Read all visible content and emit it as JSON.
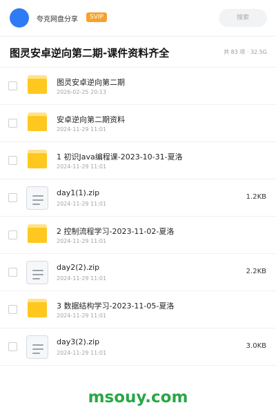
{
  "header": {
    "share_title": "夸克网盘分享",
    "badge": "SVIP",
    "search_placeholder": "搜索"
  },
  "folder": {
    "title": "图灵安卓逆向第二期-课件资料齐全",
    "summary": "共 83 项 · 32.5G"
  },
  "items": [
    {
      "type": "folder",
      "icon": "folder-icon",
      "name": "图灵安卓逆向第二期",
      "date": "2026-02-25 20:13",
      "size": ""
    },
    {
      "type": "folder",
      "icon": "folder-icon",
      "name": "安卓逆向第二期资料",
      "date": "2024-11-29 11:01",
      "size": ""
    },
    {
      "type": "folder",
      "icon": "folder-icon",
      "name": "1 初识Java编程课-2023-10-31-夏洛",
      "date": "2024-11-29 11:01",
      "size": ""
    },
    {
      "type": "file",
      "icon": "file-icon",
      "name": "day1(1).zip",
      "date": "2024-11-29 11:01",
      "size": "1.2KB"
    },
    {
      "type": "folder",
      "icon": "folder-icon",
      "name": "2 控制流程学习-2023-11-02-夏洛",
      "date": "2024-11-29 11:01",
      "size": ""
    },
    {
      "type": "file",
      "icon": "file-icon",
      "name": "day2(2).zip",
      "date": "2024-11-29 11:01",
      "size": "2.2KB"
    },
    {
      "type": "folder",
      "icon": "folder-icon",
      "name": "3 数据结构学习-2023-11-05-夏洛",
      "date": "2024-11-29 11:01",
      "size": ""
    },
    {
      "type": "file",
      "icon": "file-icon",
      "name": "day3(2).zip",
      "date": "2024-11-29 11:01",
      "size": "3.0KB"
    }
  ],
  "watermark": "msouy.com",
  "colors": {
    "accent_blue": "#2f7bf6",
    "svip_orange": "#f7a12b",
    "folder_yellow": "#ffc81e",
    "watermark_green": "#28a745"
  }
}
